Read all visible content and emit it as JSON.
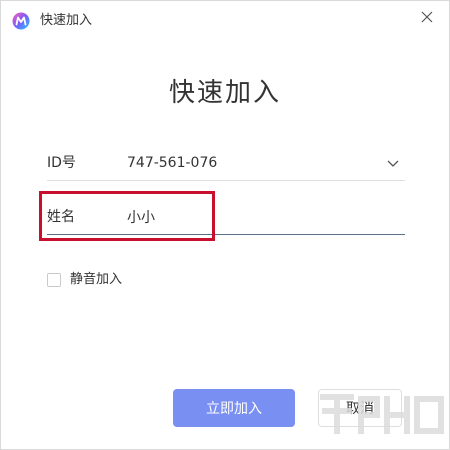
{
  "window": {
    "title": "快速加入",
    "close_glyph": "×"
  },
  "heading": "快速加入",
  "fields": {
    "id": {
      "label": "ID号",
      "value": "747-561-076"
    },
    "name": {
      "label": "姓名",
      "value": "小小"
    }
  },
  "options": {
    "mute_join": {
      "label": "静音加入",
      "checked": false
    }
  },
  "buttons": {
    "join": "立即加入",
    "cancel": "取消"
  },
  "colors": {
    "accent": "#7a8ff2",
    "highlight": "#c8102e",
    "focus_underline": "#5b6f86"
  },
  "icons": {
    "logo": "app-logo-icon",
    "close": "close-icon",
    "dropdown": "chevron-down-icon"
  }
}
